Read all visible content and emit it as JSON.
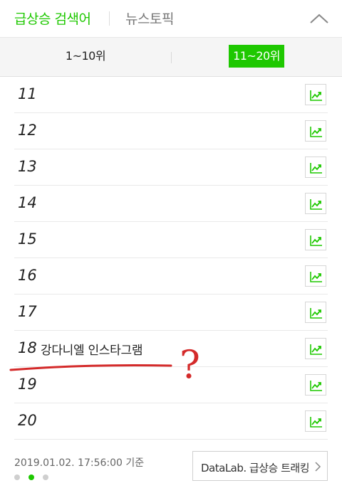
{
  "header": {
    "tab_main": "급상승 검색어",
    "tab_news": "뉴스토픽"
  },
  "range": {
    "left_label": "1~10위",
    "right_label": "11~20위",
    "selected": "11~20위"
  },
  "rows": [
    {
      "rank": "11",
      "keyword": ""
    },
    {
      "rank": "12",
      "keyword": ""
    },
    {
      "rank": "13",
      "keyword": ""
    },
    {
      "rank": "14",
      "keyword": ""
    },
    {
      "rank": "15",
      "keyword": ""
    },
    {
      "rank": "16",
      "keyword": ""
    },
    {
      "rank": "17",
      "keyword": ""
    },
    {
      "rank": "18",
      "keyword": "강다니엘 인스타그램"
    },
    {
      "rank": "19",
      "keyword": ""
    },
    {
      "rank": "20",
      "keyword": ""
    }
  ],
  "footer": {
    "timestamp": "2019.01.02. 17:56:00 기준",
    "datalab_label": "DataLab. 급상승 트래킹",
    "page_dots": 3,
    "active_dot": 1
  },
  "annotation": {
    "mark": "?",
    "color": "#d42a2a"
  },
  "colors": {
    "accent": "#1ec800"
  }
}
